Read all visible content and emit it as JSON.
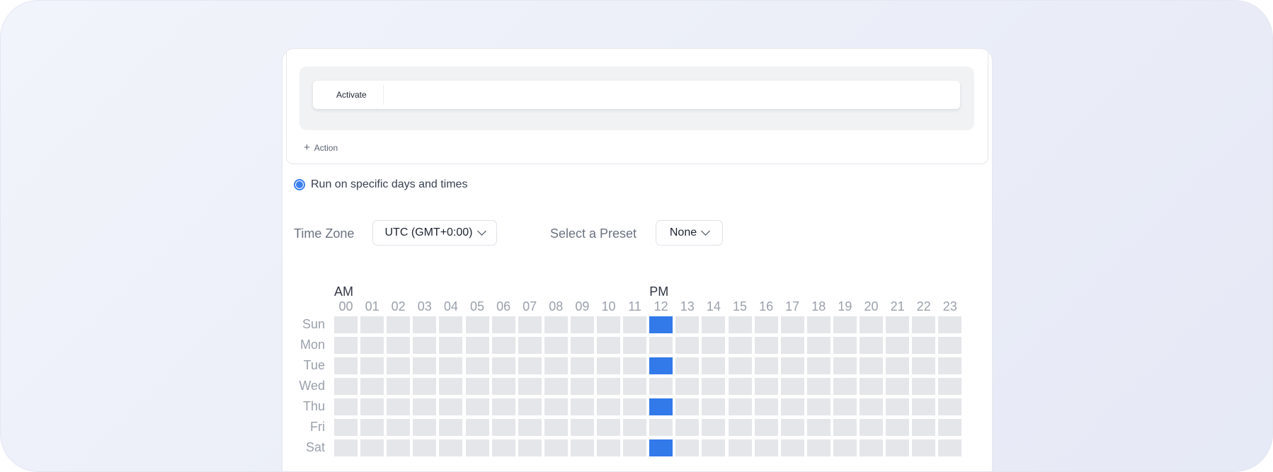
{
  "action_panel": {
    "action_label": "Activate",
    "add_action_label": "Action"
  },
  "schedule": {
    "run_option_label": "Run on specific days and times",
    "run_option_selected": true,
    "timezone_label": "Time Zone",
    "timezone_value": "UTC (GMT+0:00)",
    "preset_label": "Select a Preset",
    "preset_value": "None"
  },
  "grid": {
    "am_label": "AM",
    "pm_label": "PM",
    "hours": [
      "00",
      "01",
      "02",
      "03",
      "04",
      "05",
      "06",
      "07",
      "08",
      "09",
      "10",
      "11",
      "12",
      "13",
      "14",
      "15",
      "16",
      "17",
      "18",
      "19",
      "20",
      "21",
      "22",
      "23"
    ],
    "days": [
      "Sun",
      "Mon",
      "Tue",
      "Wed",
      "Thu",
      "Fri",
      "Sat"
    ],
    "selected": [
      {
        "day": "Sun",
        "hour": "12"
      },
      {
        "day": "Tue",
        "hour": "12"
      },
      {
        "day": "Thu",
        "hour": "12"
      },
      {
        "day": "Sat",
        "hour": "12"
      }
    ],
    "colors": {
      "empty": "#e5e6e9",
      "selected": "#3279ea"
    }
  }
}
